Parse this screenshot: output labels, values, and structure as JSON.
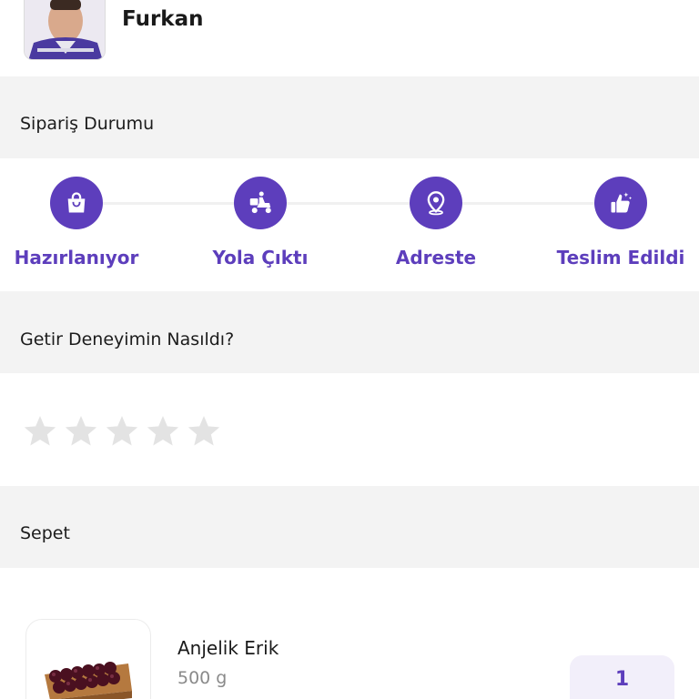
{
  "courier": {
    "name": "Furkan"
  },
  "order_status": {
    "title": "Sipariş Durumu",
    "steps": [
      {
        "label": "Hazırlanıyor",
        "icon": "shopping-bag-icon"
      },
      {
        "label": "Yola Çıktı",
        "icon": "delivery-scooter-icon"
      },
      {
        "label": "Adreste",
        "icon": "location-pin-icon"
      },
      {
        "label": "Teslim Edildi",
        "icon": "thumbs-up-icon"
      }
    ]
  },
  "rating": {
    "title": "Getir Deneyimin Nasıldı?",
    "max_stars": 5,
    "selected_stars": 0
  },
  "basket": {
    "title": "Sepet",
    "items": [
      {
        "name": "Anjelik Erik",
        "weight": "500 g",
        "quantity": "1"
      }
    ]
  },
  "colors": {
    "accent": "#5d3ebc",
    "section_background": "#f3f3f3",
    "star_inactive": "#e3e3e3",
    "quantity_background": "#f2effa"
  }
}
